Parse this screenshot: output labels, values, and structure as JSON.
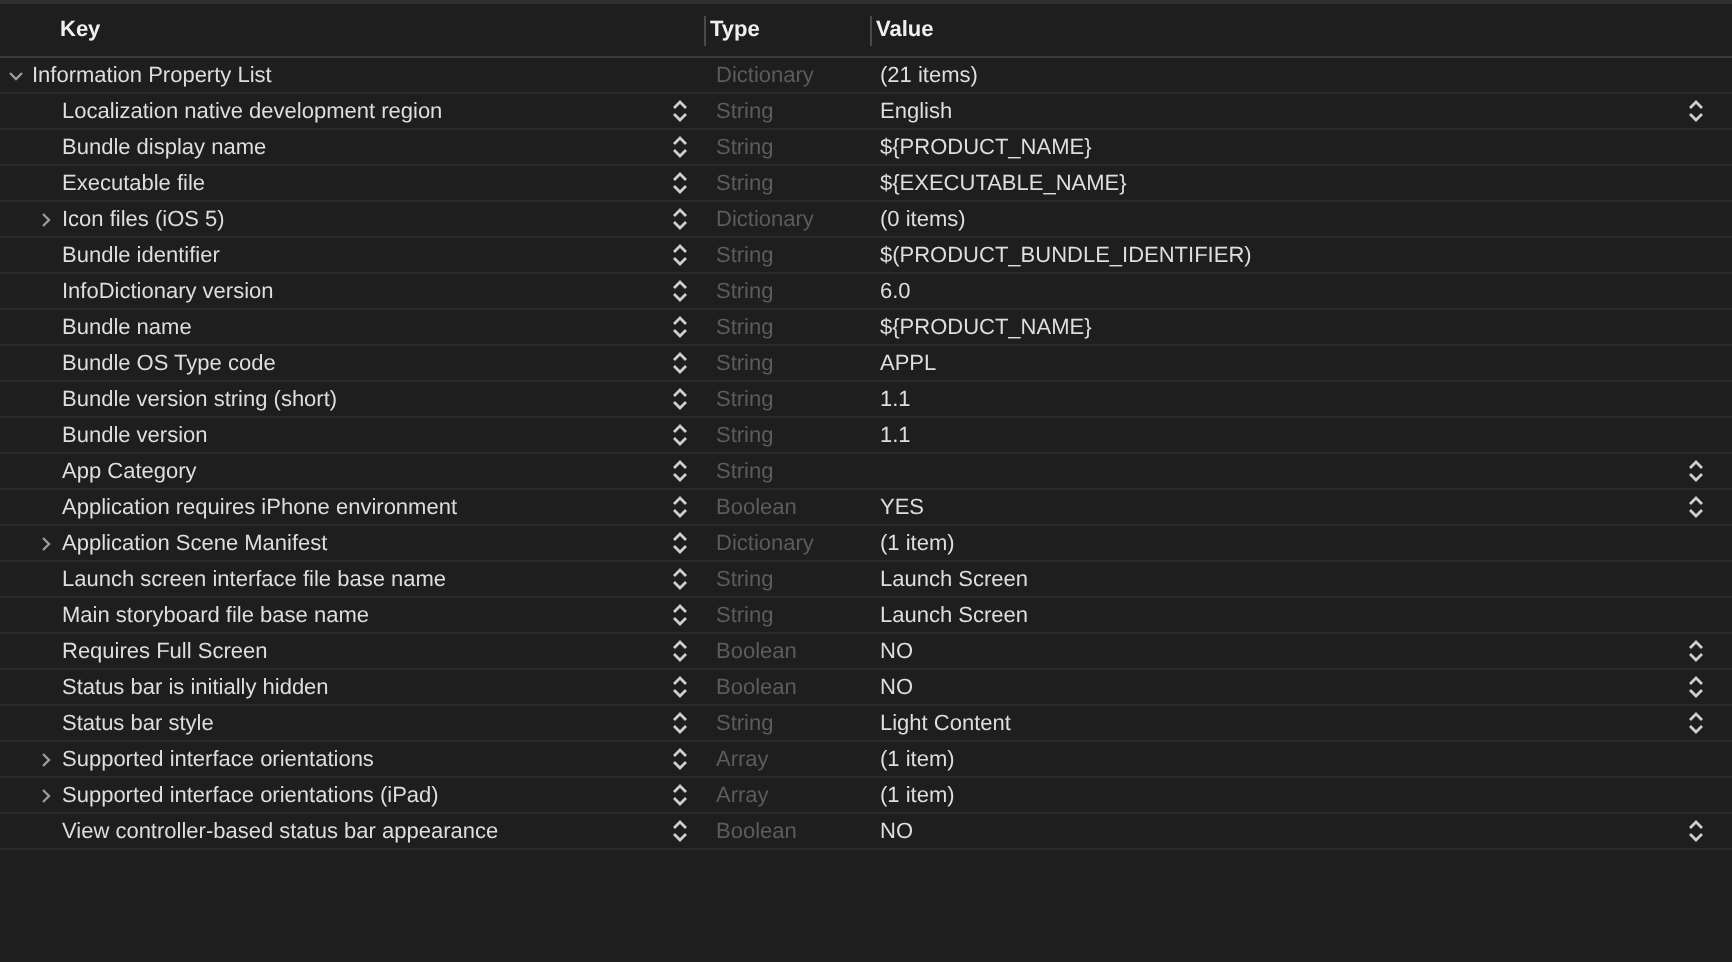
{
  "columns": [
    {
      "label": "Key"
    },
    {
      "label": "Type"
    },
    {
      "label": "Value"
    }
  ],
  "root": {
    "key": "Information Property List",
    "type": "Dictionary",
    "value": "(21 items)",
    "expanded": true,
    "children": [
      {
        "key": "Localization native development region",
        "type": "String",
        "value": "English",
        "popup": true
      },
      {
        "key": "Bundle display name",
        "type": "String",
        "value": "${PRODUCT_NAME}",
        "popup": false
      },
      {
        "key": "Executable file",
        "type": "String",
        "value": "${EXECUTABLE_NAME}",
        "popup": false
      },
      {
        "key": "Icon files (iOS 5)",
        "type": "Dictionary",
        "value": "(0 items)",
        "popup": false,
        "expanded": false
      },
      {
        "key": "Bundle identifier",
        "type": "String",
        "value": "$(PRODUCT_BUNDLE_IDENTIFIER)",
        "popup": false
      },
      {
        "key": "InfoDictionary version",
        "type": "String",
        "value": "6.0",
        "popup": false
      },
      {
        "key": "Bundle name",
        "type": "String",
        "value": "${PRODUCT_NAME}",
        "popup": false
      },
      {
        "key": "Bundle OS Type code",
        "type": "String",
        "value": "APPL",
        "popup": false
      },
      {
        "key": "Bundle version string (short)",
        "type": "String",
        "value": "1.1",
        "popup": false
      },
      {
        "key": "Bundle version",
        "type": "String",
        "value": "1.1",
        "popup": false
      },
      {
        "key": "App Category",
        "type": "String",
        "popup": true
      },
      {
        "key": "Application requires iPhone environment",
        "type": "Boolean",
        "value": "YES",
        "popup": true
      },
      {
        "key": "Application Scene Manifest",
        "type": "Dictionary",
        "value": "(1 item)",
        "popup": false,
        "expanded": false
      },
      {
        "key": "Launch screen interface file base name",
        "type": "String",
        "value": "Launch Screen",
        "popup": false
      },
      {
        "key": "Main storyboard file base name",
        "type": "String",
        "value": "Launch Screen",
        "popup": false
      },
      {
        "key": "Requires Full Screen",
        "type": "Boolean",
        "value": "NO",
        "popup": true
      },
      {
        "key": "Status bar is initially hidden",
        "type": "Boolean",
        "value": "NO",
        "popup": true
      },
      {
        "key": "Status bar style",
        "type": "String",
        "value": "Light Content",
        "popup": true
      },
      {
        "key": "Supported interface orientations",
        "type": "Array",
        "value": "(1 item)",
        "popup": false,
        "expanded": false
      },
      {
        "key": "Supported interface orientations (iPad)",
        "type": "Array",
        "value": "(1 item)",
        "popup": false,
        "expanded": false
      },
      {
        "key": "View controller-based status bar appearance",
        "type": "Boolean",
        "value": "NO",
        "popup": true
      }
    ]
  }
}
